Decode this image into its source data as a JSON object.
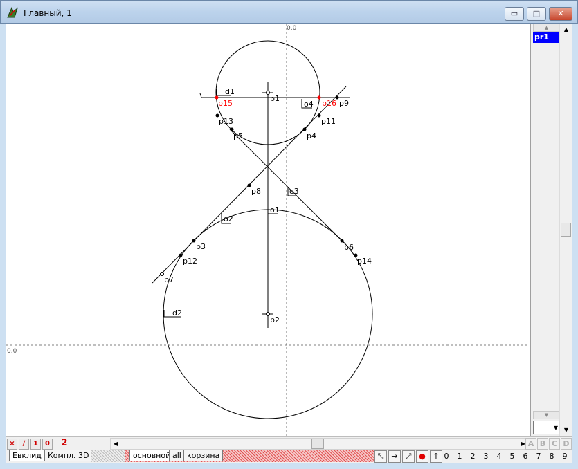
{
  "window": {
    "title": "Главный, 1",
    "btn_min": "▭",
    "btn_max": "□",
    "btn_close": "✕"
  },
  "canvas": {
    "origin_x_label": "0.0",
    "origin_y_label": "0.0",
    "labels": {
      "d1": "d1",
      "d2": "d2",
      "p1": "p1",
      "p2": "p2",
      "p3": "p3",
      "p4": "p4",
      "p5": "p5",
      "p6": "p6",
      "p7": "p7",
      "p8": "p8",
      "p9": "p9",
      "p11": "p11",
      "p12": "p12",
      "p13": "p13",
      "p14": "p14",
      "p15": "p15",
      "p16": "p16",
      "o1": "o1",
      "o2": "o2",
      "o3": "o3",
      "o4": "o4"
    },
    "highlight_color": "#ff0000"
  },
  "layers": {
    "items": [
      "pr1"
    ],
    "selected": "pr1"
  },
  "bottom_toolbar": {
    "mode_buttons": [
      "×",
      "∕",
      "1",
      "0"
    ],
    "counter": "2",
    "abcd": [
      "A",
      "B",
      "C",
      "D"
    ],
    "mode_tabs": [
      "Евклид",
      "Компл.",
      "3D"
    ],
    "sheet_tabs": [
      "основной",
      "all",
      "корзина"
    ],
    "tools": [
      "⤡",
      "→",
      "⤢",
      "●",
      "↑"
    ],
    "digits": [
      "0",
      "1",
      "2",
      "3",
      "4",
      "5",
      "6",
      "7",
      "8",
      "9"
    ]
  }
}
